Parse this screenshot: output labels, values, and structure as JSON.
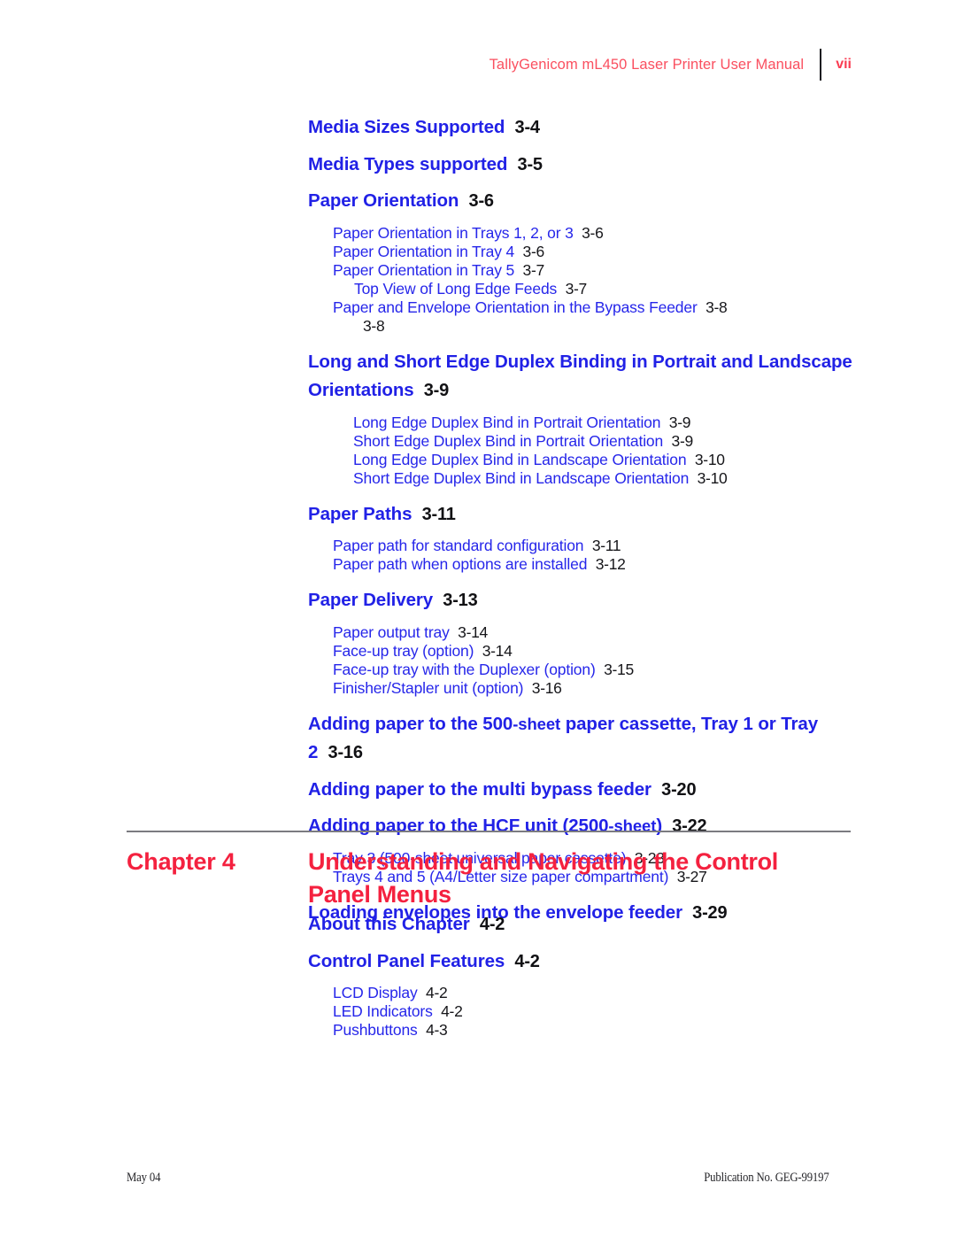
{
  "header": {
    "title": "TallyGenicom mL450 Laser Printer User Manual",
    "folio": "vii"
  },
  "colors": {
    "heading_blue": "#2121e6",
    "entry_blue": "#2626ea",
    "page_number_black": "#16161a",
    "header_red": "#fa4f5f",
    "chapter_red": "#f4213f",
    "rule_gray": "#7b7b80"
  },
  "toc": {
    "entries": [
      {
        "level": 1,
        "text": "Media Sizes Supported",
        "page": "3-4"
      },
      {
        "level": 1,
        "text": "Media Types supported",
        "page": "3-5"
      },
      {
        "level": 1,
        "text": "Paper Orientation",
        "page": "3-6"
      },
      {
        "level": 2,
        "text": "Paper Orientation in Trays 1, 2, or 3",
        "page": "3-6"
      },
      {
        "level": 2,
        "text": "Paper Orientation in Tray 4",
        "page": "3-6"
      },
      {
        "level": 2,
        "text": "Paper Orientation in Tray 5",
        "page": "3-7"
      },
      {
        "level": 3,
        "text": "Top View of Long Edge Feeds",
        "page": "3-7"
      },
      {
        "level": 2,
        "text": "Paper and Envelope Orientation in the Bypass Feeder",
        "page": "3-8"
      },
      {
        "level": "orphan",
        "text": "",
        "page": "3-8"
      },
      {
        "level": 1,
        "text": "Long and Short Edge Duplex Binding in Portrait and Landscape Orientations",
        "page": "3-9"
      },
      {
        "level": 2,
        "deep": true,
        "text": "Long Edge Duplex Bind in Portrait Orientation",
        "page": "3-9"
      },
      {
        "level": 2,
        "deep": true,
        "text": "Short Edge Duplex Bind in Portrait Orientation",
        "page": "3-9"
      },
      {
        "level": 2,
        "deep": true,
        "text": "Long Edge Duplex Bind in Landscape Orientation",
        "page": "3-10"
      },
      {
        "level": 2,
        "deep": true,
        "text": "Short Edge Duplex Bind in Landscape Orientation",
        "page": "3-10"
      },
      {
        "level": 1,
        "text": "Paper Paths",
        "page": "3-11"
      },
      {
        "level": 2,
        "text": "Paper path for standard configuration",
        "page": "3-11"
      },
      {
        "level": 2,
        "text": "Paper path when options are installed",
        "page": "3-12"
      },
      {
        "level": 1,
        "text": "Paper Delivery",
        "page": "3-13"
      },
      {
        "level": 2,
        "text": "Paper output tray",
        "page": "3-14"
      },
      {
        "level": 2,
        "text": "Face-up tray (option)",
        "page": "3-14"
      },
      {
        "level": 2,
        "text": "Face-up tray with the Duplexer (option)",
        "page": "3-15"
      },
      {
        "level": 2,
        "text": "Finisher/Stapler unit (option)",
        "page": "3-16"
      },
      {
        "level": 1,
        "text": "Adding paper to the 500-sheet paper cassette, Tray 1 or Tray 2",
        "page": "3-16"
      },
      {
        "level": 1,
        "text": "Adding paper to the multi bypass feeder",
        "page": "3-20"
      },
      {
        "level": 1,
        "text": "Adding paper to the HCF unit (2500-sheet)",
        "page": "3-22"
      },
      {
        "level": 2,
        "text": "Tray 3 (500-sheet universal paper cassette)",
        "page": "3-23"
      },
      {
        "level": 2,
        "text": "Trays 4 and 5 (A4/Letter size paper compartment)",
        "page": "3-27"
      },
      {
        "level": 1,
        "text": "Loading envelopes into the envelope feeder",
        "page": "3-29"
      }
    ]
  },
  "chapter": {
    "label": "Chapter 4",
    "title": "Understanding and Navigating the Control Panel Menus",
    "entries": [
      {
        "level": 1,
        "text": "About this Chapter",
        "page": "4-2"
      },
      {
        "level": 1,
        "text": "Control Panel Features",
        "page": "4-2"
      },
      {
        "level": 2,
        "text": "LCD Display",
        "page": "4-2"
      },
      {
        "level": 2,
        "text": "LED Indicators",
        "page": "4-2"
      },
      {
        "level": 2,
        "text": "Pushbuttons",
        "page": "4-3"
      }
    ]
  },
  "footer": {
    "left": "May 04",
    "right": "Publication No. GEG-99197"
  }
}
